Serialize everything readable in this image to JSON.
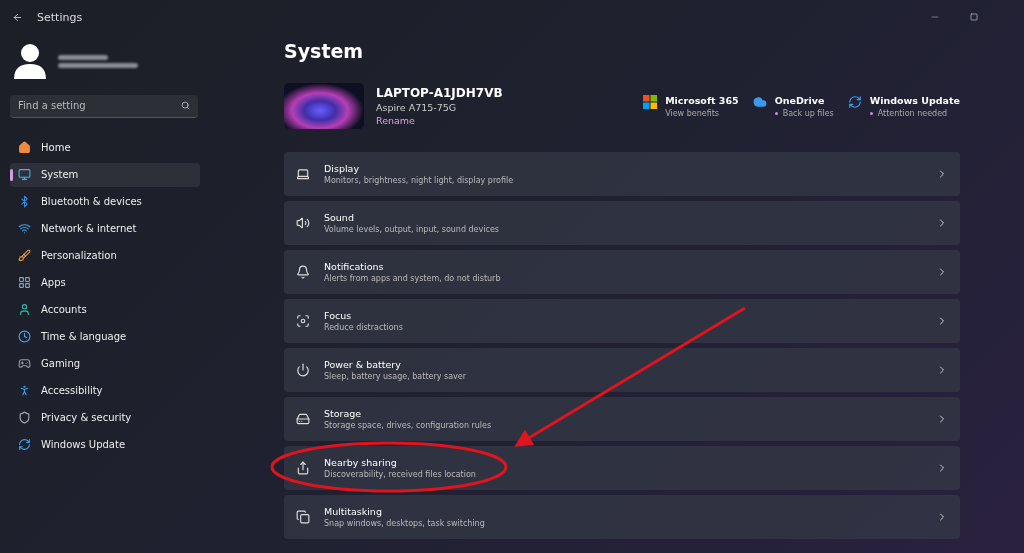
{
  "window": {
    "title": "Settings"
  },
  "search": {
    "placeholder": "Find a setting"
  },
  "sidebar": {
    "items": [
      {
        "label": "Home",
        "selected": false
      },
      {
        "label": "System",
        "selected": true
      },
      {
        "label": "Bluetooth & devices",
        "selected": false
      },
      {
        "label": "Network & internet",
        "selected": false
      },
      {
        "label": "Personalization",
        "selected": false
      },
      {
        "label": "Apps",
        "selected": false
      },
      {
        "label": "Accounts",
        "selected": false
      },
      {
        "label": "Time & language",
        "selected": false
      },
      {
        "label": "Gaming",
        "selected": false
      },
      {
        "label": "Accessibility",
        "selected": false
      },
      {
        "label": "Privacy & security",
        "selected": false
      },
      {
        "label": "Windows Update",
        "selected": false
      }
    ]
  },
  "page_title": "System",
  "device": {
    "name": "LAPTOP-A1JDH7VB",
    "model": "Aspire A715-75G",
    "rename": "Rename"
  },
  "services": [
    {
      "title": "Microsoft 365",
      "subtitle": "View benefits",
      "dot": false
    },
    {
      "title": "OneDrive",
      "subtitle": "Back up files",
      "dot": true
    },
    {
      "title": "Windows Update",
      "subtitle": "Attention needed",
      "dot": true
    }
  ],
  "settings": [
    {
      "title": "Display",
      "subtitle": "Monitors, brightness, night light, display profile"
    },
    {
      "title": "Sound",
      "subtitle": "Volume levels, output, input, sound devices"
    },
    {
      "title": "Notifications",
      "subtitle": "Alerts from apps and system, do not disturb"
    },
    {
      "title": "Focus",
      "subtitle": "Reduce distractions"
    },
    {
      "title": "Power & battery",
      "subtitle": "Sleep, battery usage, battery saver"
    },
    {
      "title": "Storage",
      "subtitle": "Storage space, drives, configuration rules"
    },
    {
      "title": "Nearby sharing",
      "subtitle": "Discoverability, received files location"
    },
    {
      "title": "Multitasking",
      "subtitle": "Snap windows, desktops, task switching"
    }
  ]
}
